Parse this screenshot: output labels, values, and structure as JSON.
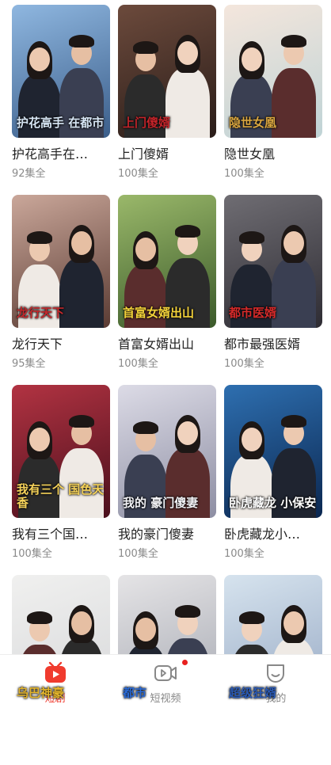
{
  "dramas": [
    {
      "name": "护花高手在…",
      "episodes": "92集全",
      "poster_text": "护花高手 在都市",
      "bg": [
        "#8fb7e0",
        "#3b5e8a"
      ],
      "accent": "#d7e6f5"
    },
    {
      "name": "上门傻婿",
      "episodes": "100集全",
      "poster_text": "上门傻婿",
      "bg": [
        "#6c4a3c",
        "#2a1d19"
      ],
      "accent": "#c2242a"
    },
    {
      "name": "隐世女凰",
      "episodes": "100集全",
      "poster_text": "隐世女凰",
      "bg": [
        "#f4e6dc",
        "#bfd3d6"
      ],
      "accent": "#d9a640"
    },
    {
      "name": "龙行天下",
      "episodes": "95集全",
      "poster_text": "龙行天下",
      "bg": [
        "#caa79a",
        "#5a3b33"
      ],
      "accent": "#c3282c"
    },
    {
      "name": "首富女婿出山",
      "episodes": "100集全",
      "poster_text": "首富女婿出山",
      "bg": [
        "#9ab86a",
        "#3b5a2a"
      ],
      "accent": "#f3d23a"
    },
    {
      "name": "都市最强医婿",
      "episodes": "100集全",
      "poster_text": "都市医婿",
      "bg": [
        "#6f6d73",
        "#2e2c33"
      ],
      "accent": "#d52a2a"
    },
    {
      "name": "我有三个国…",
      "episodes": "100集全",
      "poster_text": "我有三个 国色天香",
      "bg": [
        "#b23342",
        "#4a0f1c"
      ],
      "accent": "#f5d25a"
    },
    {
      "name": "我的豪门傻妻",
      "episodes": "100集全",
      "poster_text": "我的 豪门傻妻",
      "bg": [
        "#dcdbe6",
        "#8d8ea3"
      ],
      "accent": "#f2f2f6"
    },
    {
      "name": "卧虎藏龙小…",
      "episodes": "100集全",
      "poster_text": "卧虎藏龙 小保安",
      "bg": [
        "#2e6fb0",
        "#0b2750"
      ],
      "accent": "#ffffff"
    },
    {
      "name": "",
      "episodes": "",
      "poster_text": "乌巴神豪",
      "bg": [
        "#f0f0ef",
        "#d7d8da"
      ],
      "accent": "#e3b52d"
    },
    {
      "name": "",
      "episodes": "",
      "poster_text": "都市",
      "bg": [
        "#e5e4e6",
        "#a6a9b2"
      ],
      "accent": "#2a6ad6"
    },
    {
      "name": "",
      "episodes": "",
      "poster_text": "超级狂婿",
      "bg": [
        "#d6e3ee",
        "#97a9c4"
      ],
      "accent": "#2a5ab5"
    }
  ],
  "tabbar": {
    "tabs": [
      {
        "label": "短剧",
        "icon": "tv-icon",
        "active": true
      },
      {
        "label": "短视频",
        "icon": "video-icon",
        "active": false
      },
      {
        "label": "我的",
        "icon": "profile-icon",
        "active": false
      }
    ]
  },
  "colors": {
    "active": "#f03b2e",
    "inactive": "#888888",
    "badge": "#e8201f"
  }
}
